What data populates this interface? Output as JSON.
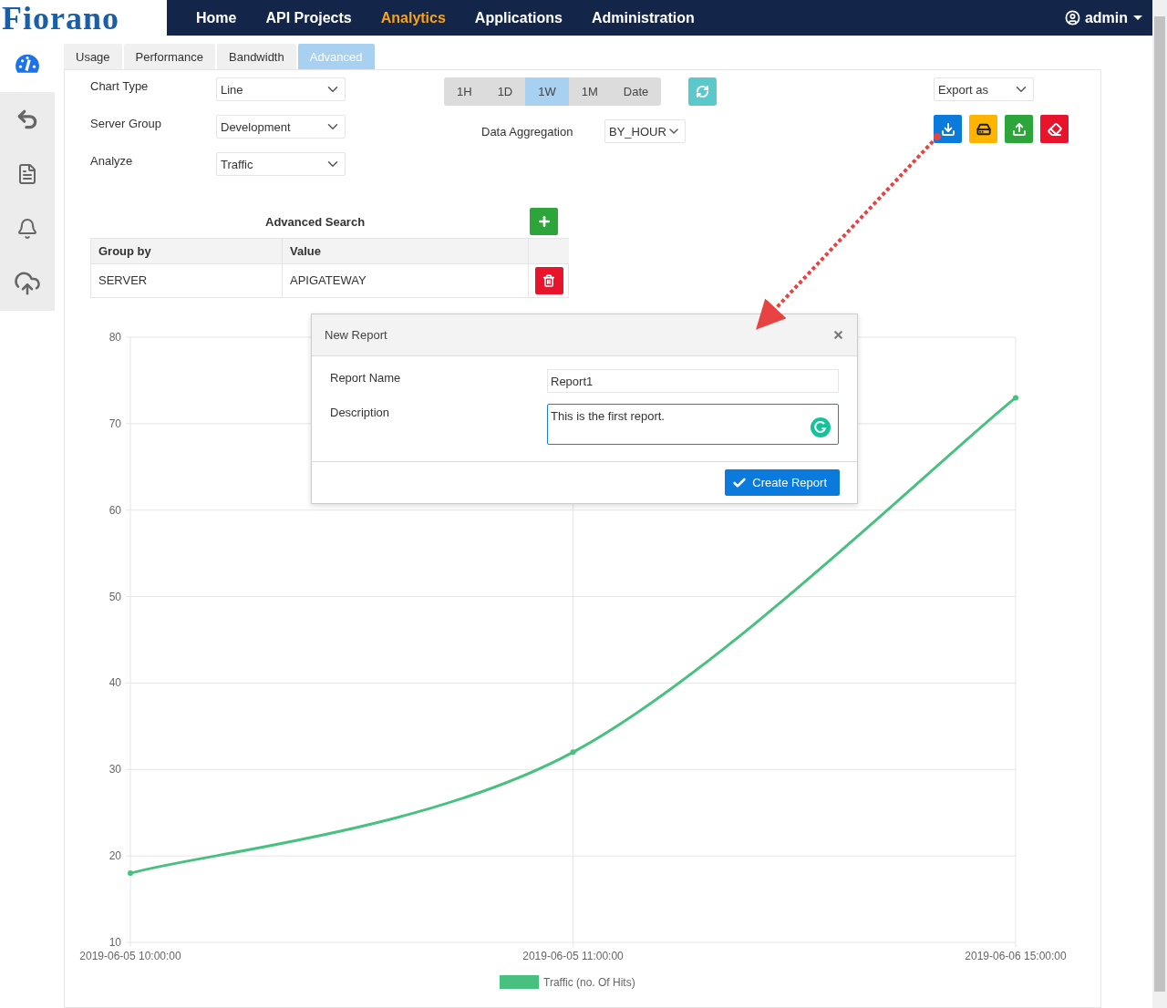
{
  "nav": {
    "logo": "Fiorano",
    "items": [
      {
        "label": "Home",
        "selected": false
      },
      {
        "label": "API Projects",
        "selected": false
      },
      {
        "label": "Analytics",
        "selected": true
      },
      {
        "label": "Applications",
        "selected": false
      },
      {
        "label": "Administration",
        "selected": false
      }
    ],
    "user": "admin"
  },
  "sidebar": {
    "items": [
      {
        "kind": "dashboard",
        "selected": true
      },
      {
        "kind": "back",
        "selected": false
      },
      {
        "kind": "document",
        "selected": false
      },
      {
        "kind": "bell",
        "selected": false
      },
      {
        "kind": "cloud",
        "selected": false
      }
    ]
  },
  "tabs": [
    {
      "label": "Usage",
      "selected": false
    },
    {
      "label": "Performance",
      "selected": false
    },
    {
      "label": "Bandwidth",
      "selected": false
    },
    {
      "label": "Advanced",
      "selected": true
    }
  ],
  "filters": [
    {
      "label": "Chart Type",
      "value": "Line"
    },
    {
      "label": "Server Group",
      "value": "Development"
    },
    {
      "label": "Analyze",
      "value": "Traffic"
    }
  ],
  "time_range": [
    {
      "label": "1H",
      "selected": false
    },
    {
      "label": "1D",
      "selected": false
    },
    {
      "label": "1W",
      "selected": true
    },
    {
      "label": "1M",
      "selected": false
    },
    {
      "label": "Date",
      "selected": false
    }
  ],
  "aggregation": {
    "label": "Data Aggregation",
    "value": "BY_HOUR"
  },
  "export": {
    "placeholder": "Export as"
  },
  "action_buttons": [
    {
      "kind": "download",
      "color": "#0a7bdc"
    },
    {
      "kind": "drive",
      "color": "#ffb400"
    },
    {
      "kind": "upload",
      "color": "#2ca53a"
    },
    {
      "kind": "eraser",
      "color": "#e8142b"
    }
  ],
  "advanced_search": {
    "title": "Advanced Search",
    "columns": [
      "Group by",
      "Value"
    ],
    "rows": [
      [
        "SERVER",
        "APIGATEWAY"
      ]
    ]
  },
  "chart": {
    "chart_data": {
      "type": "line",
      "categories": [
        "2019-06-05 10:00:00",
        "2019-06-05 11:00:00",
        "2019-06-06 15:00:00"
      ],
      "series": [
        {
          "name": "Traffic (no. Of Hits)",
          "color": "#48c07f",
          "marker": true,
          "values": [
            18,
            32,
            73
          ]
        }
      ],
      "grid": true,
      "ylim": [
        10,
        80
      ],
      "yticks": [
        10,
        20,
        30,
        40,
        50,
        60,
        70,
        80
      ]
    }
  },
  "modal": {
    "title": "New Report",
    "fields": [
      {
        "kind": "input",
        "label": "Report Name",
        "value": "Report1"
      },
      {
        "kind": "textarea",
        "label": "Description",
        "value": "This is the first report."
      }
    ],
    "button": "Create Report"
  }
}
